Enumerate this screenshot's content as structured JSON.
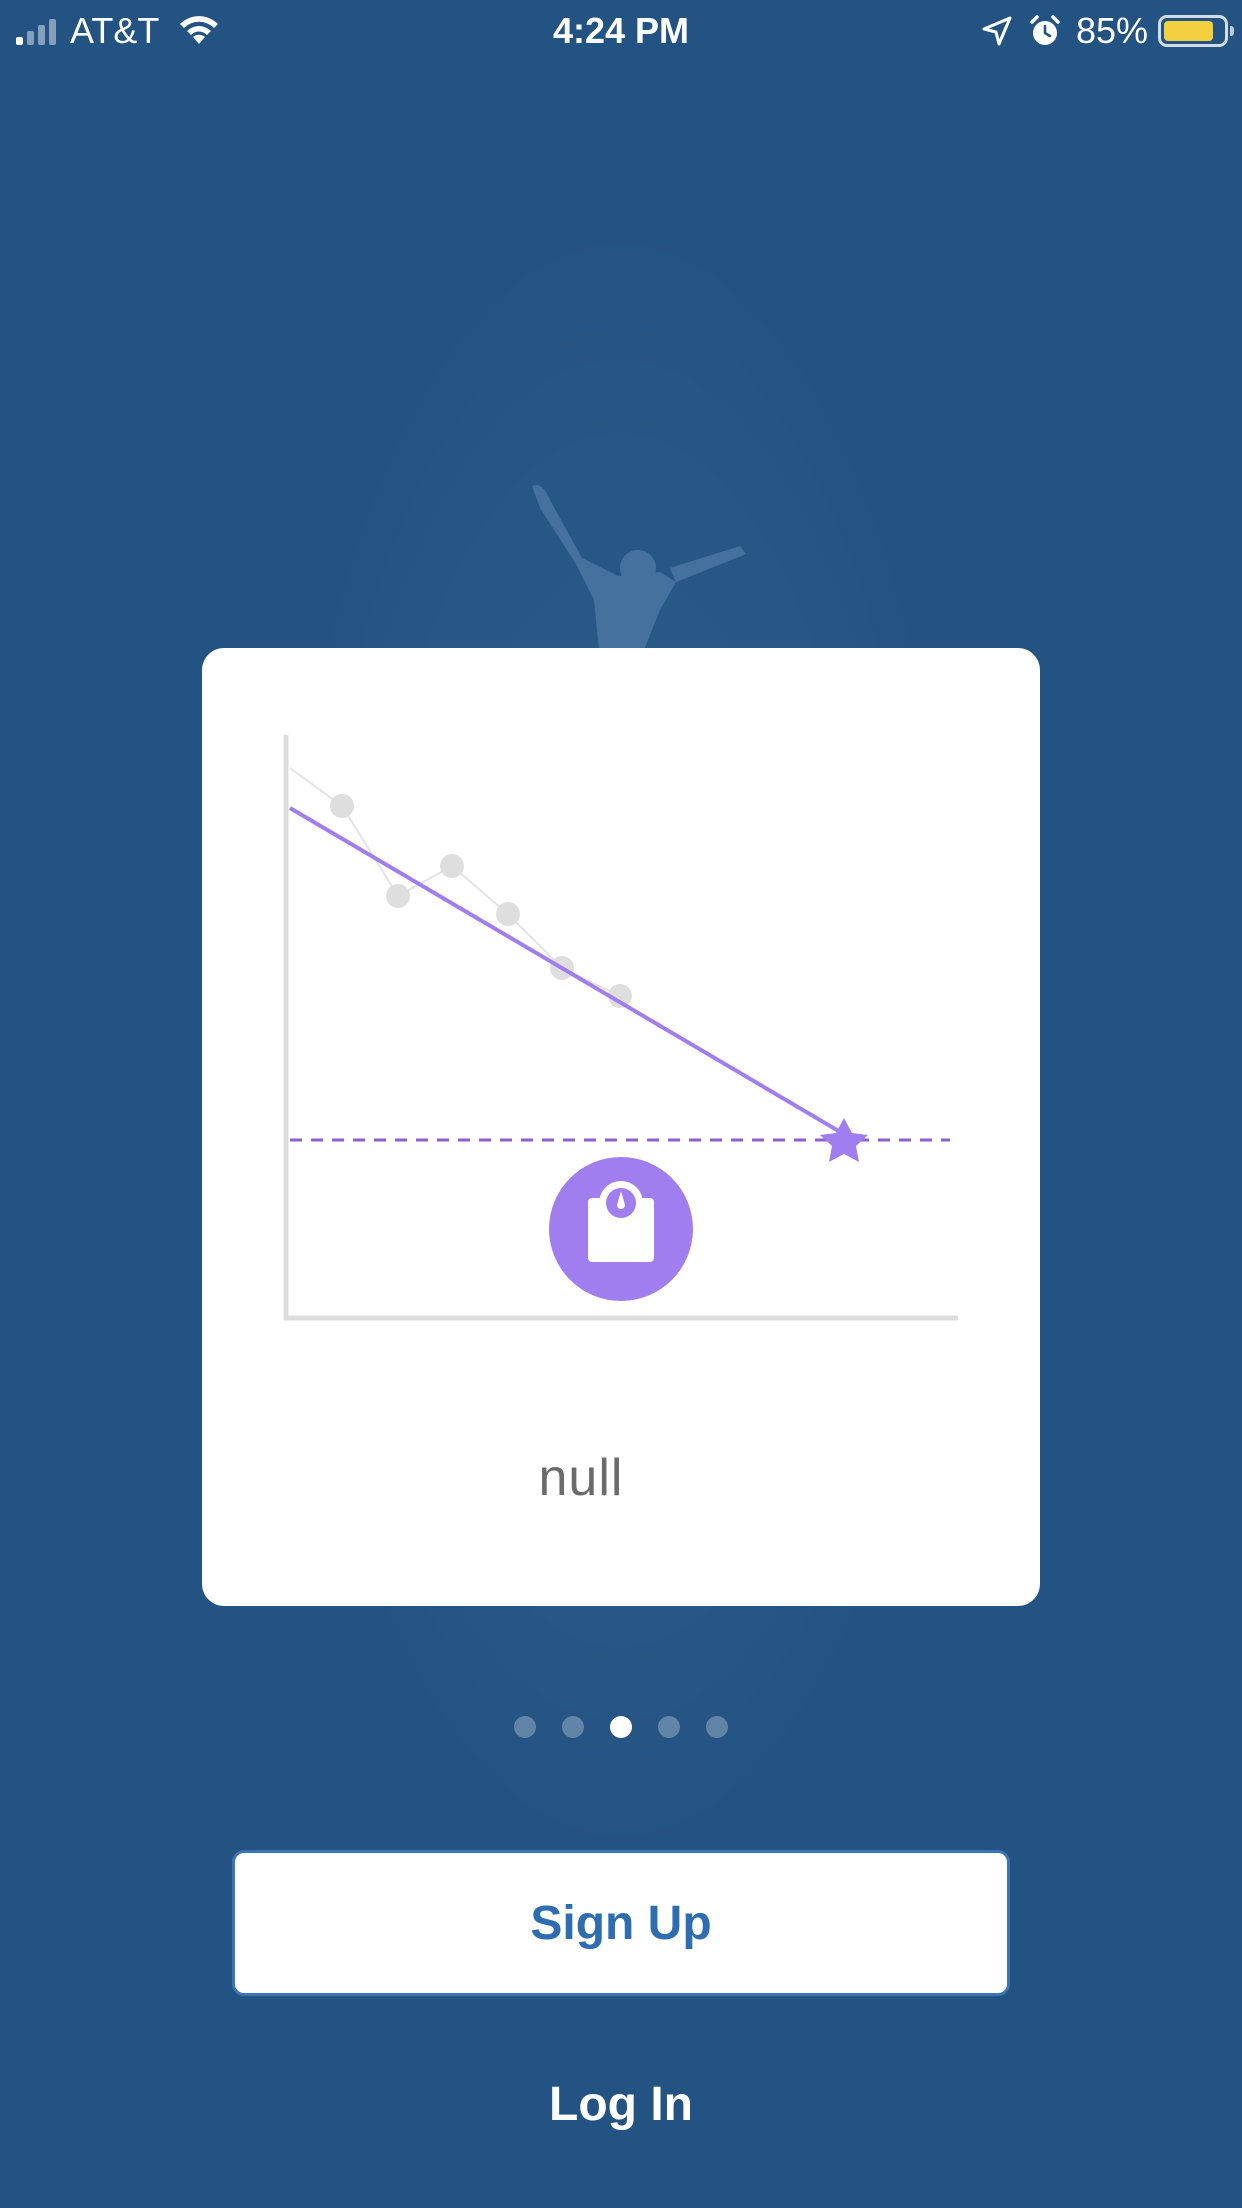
{
  "status_bar": {
    "carrier": "AT&T",
    "time": "4:24 PM",
    "battery_percent": "85%",
    "battery_level": 0.85,
    "battery_color": "#f4d03f",
    "icons": [
      "cellular-signal-icon",
      "wifi-icon",
      "location-arrow-icon",
      "alarm-clock-icon",
      "battery-icon"
    ]
  },
  "colors": {
    "background": "#235383",
    "card": "#ffffff",
    "accent_purple": "#a07ef0",
    "button_text_blue": "#2e6db0"
  },
  "onboarding_card": {
    "illustration": "weight-loss-trend-chart",
    "icons": [
      "bathroom-scale-icon",
      "goal-star-icon"
    ],
    "caption": "null"
  },
  "pager": {
    "total_pages": 5,
    "current_page": 3
  },
  "actions": {
    "signup_label": "Sign Up",
    "login_label": "Log In"
  }
}
